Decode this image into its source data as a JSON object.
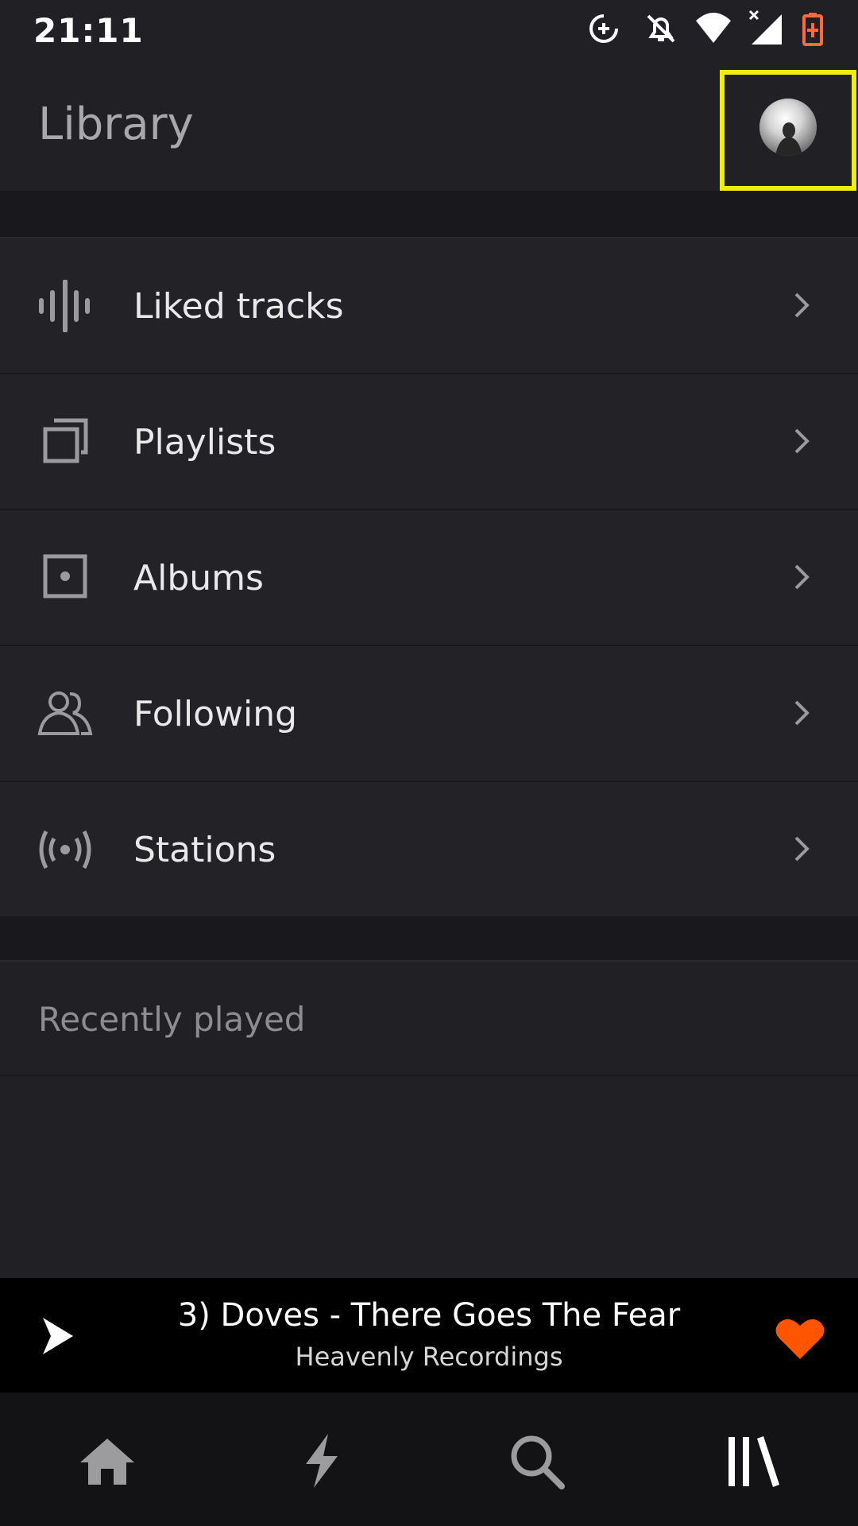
{
  "status_bar": {
    "time": "21:11",
    "icons": [
      "data-saver-icon",
      "notifications-off-icon",
      "wifi-icon",
      "cellular-signal-icon",
      "battery-charging-icon"
    ]
  },
  "header": {
    "title": "Library",
    "avatar_icon": "profile-avatar-icon"
  },
  "library": {
    "items": [
      {
        "label": "Liked tracks",
        "icon": "waveform-icon"
      },
      {
        "label": "Playlists",
        "icon": "playlist-stack-icon"
      },
      {
        "label": "Albums",
        "icon": "album-icon"
      },
      {
        "label": "Following",
        "icon": "people-icon"
      },
      {
        "label": "Stations",
        "icon": "broadcast-icon"
      }
    ]
  },
  "recently_played": {
    "title": "Recently played"
  },
  "mini_player": {
    "track_title": "3) Doves - There Goes The Fear",
    "track_subtitle": "Heavenly Recordings",
    "play_icon": "play-icon",
    "like_icon": "heart-icon",
    "like_color": "#ff5500"
  },
  "bottom_nav": {
    "items": [
      {
        "name": "home",
        "icon": "home-icon"
      },
      {
        "name": "stream",
        "icon": "lightning-icon"
      },
      {
        "name": "search",
        "icon": "search-icon"
      },
      {
        "name": "library",
        "icon": "library-icon"
      }
    ]
  },
  "colors": {
    "background": "#212024",
    "highlight_box": "#f3ec0a",
    "accent": "#ff5500",
    "battery": "#ff6a3d"
  }
}
